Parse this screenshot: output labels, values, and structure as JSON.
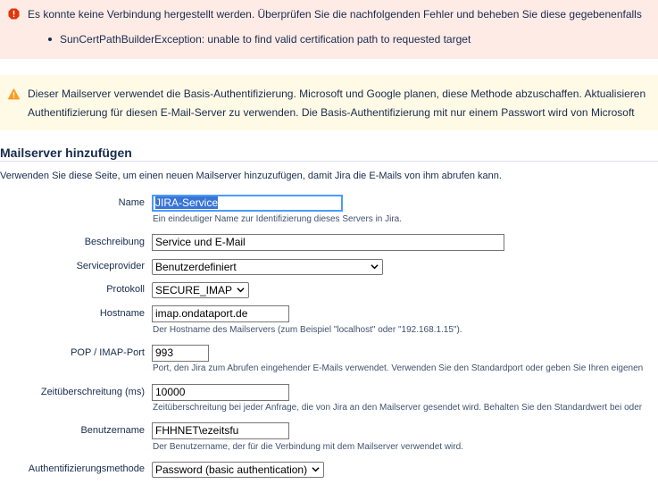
{
  "error_banner": {
    "message": "Es konnte keine Verbindung hergestellt werden. Überprüfen Sie die nachfolgenden Fehler und beheben Sie diese gegebenenfalls",
    "errors": [
      "SunCertPathBuilderException: unable to find valid certification path to requested target"
    ],
    "icon": "error-icon",
    "color": "#de350b"
  },
  "warning_banner": {
    "line1": "Dieser Mailserver verwendet die Basis-Authentifizierung. Microsoft und Google planen, diese Methode abzuschaffen. Aktualisieren",
    "line2": "Authentifizierung für diesen E-Mail-Server zu verwenden. Die Basis-Authentifizierung mit nur einem Passwort wird von Microsoft",
    "icon": "warning-icon",
    "color": "#ff991f"
  },
  "page": {
    "title": "Mailserver hinzufügen",
    "intro": "Verwenden Sie diese Seite, um einen neuen Mailserver hinzuzufügen, damit Jira die E-Mails von ihm abrufen kann."
  },
  "form": {
    "name": {
      "label": "Name",
      "value": "JIRA-Service",
      "description": "Ein eindeutiger Name zur Identifizierung dieses Servers in Jira."
    },
    "beschreibung": {
      "label": "Beschreibung",
      "value": "Service und E-Mail"
    },
    "serviceprovider": {
      "label": "Serviceprovider",
      "selected": "Benutzerdefiniert"
    },
    "protokoll": {
      "label": "Protokoll",
      "selected": "SECURE_IMAP"
    },
    "hostname": {
      "label": "Hostname",
      "value": "imap.ondataport.de",
      "description": "Der Hostname des Mailservers (zum Beispiel \"localhost\" oder \"192.168.1.15\")."
    },
    "port": {
      "label": "POP / IMAP-Port",
      "value": "993",
      "description": "Port, den Jira zum Abrufen eingehender E-Mails verwendet. Verwenden Sie den Standardport oder geben Sie Ihren eigenen"
    },
    "timeout": {
      "label": "Zeitüberschreitung (ms)",
      "value": "10000",
      "description": "Zeitüberschreitung bei jeder Anfrage, die von Jira an den Mailserver gesendet wird. Behalten Sie den Standardwert bei oder"
    },
    "benutzername": {
      "label": "Benutzername",
      "value": "FHHNET\\ezeitsfu",
      "description": "Der Benutzername, der für die Verbindung mit dem Mailserver verwendet wird."
    },
    "auth": {
      "label": "Authentifizierungsmethode",
      "selected": "Password (basic authentication)"
    }
  }
}
